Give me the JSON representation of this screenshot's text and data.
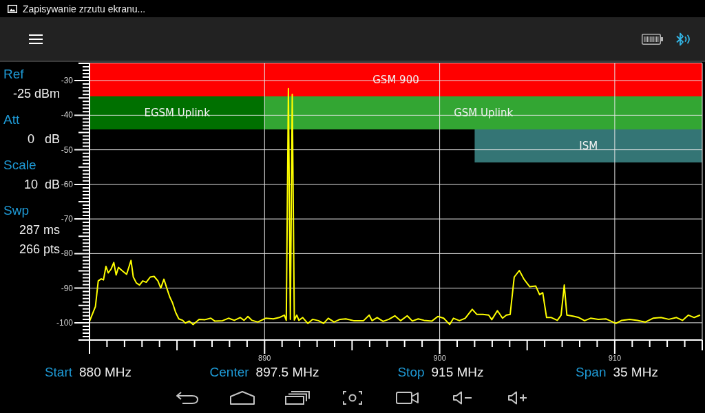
{
  "status_bar": {
    "notification": "Zapisywanie zrzutu ekranu..."
  },
  "parameters": [
    {
      "label": "Ref",
      "values": [
        "-25 dBm"
      ]
    },
    {
      "label": "Att",
      "values": [
        "0   dB"
      ]
    },
    {
      "label": "Scale",
      "values": [
        "10  dB"
      ]
    },
    {
      "label": "Swp",
      "values": [
        "287 ms",
        "266 pts"
      ]
    }
  ],
  "spectrum": {
    "chart_data": {
      "type": "line",
      "xlim": [
        880,
        915
      ],
      "ylim": [
        -105,
        -25
      ],
      "xticks": [
        890,
        900,
        910
      ],
      "yticks": [
        -30,
        -40,
        -50,
        -60,
        -70,
        -80,
        -90,
        -100
      ],
      "grid": true,
      "x": [
        880.0,
        880.34,
        880.5,
        880.67,
        880.8,
        880.94,
        881.07,
        881.23,
        881.39,
        881.52,
        881.65,
        881.9,
        882.12,
        882.37,
        882.5,
        882.68,
        882.86,
        883.04,
        883.24,
        883.47,
        883.69,
        883.91,
        884.07,
        884.25,
        884.43,
        884.58,
        884.74,
        884.92,
        885.1,
        885.32,
        885.48,
        885.7,
        885.92,
        886.26,
        886.6,
        886.93,
        887.15,
        887.6,
        887.94,
        888.27,
        888.61,
        888.83,
        889.05,
        889.28,
        889.61,
        890.06,
        890.5,
        890.84,
        891.13,
        891.24,
        891.36,
        891.47,
        891.58,
        891.7,
        891.84,
        891.96,
        892.18,
        892.47,
        892.74,
        893.08,
        893.37,
        893.64,
        893.97,
        894.31,
        894.64,
        895.09,
        895.65,
        895.98,
        896.14,
        896.43,
        896.77,
        897.1,
        897.44,
        897.77,
        898.15,
        898.44,
        898.78,
        899.11,
        899.56,
        899.9,
        900.23,
        900.57,
        900.79,
        901.13,
        901.46,
        901.86,
        902.13,
        902.47,
        902.8,
        902.98,
        903.3,
        903.59,
        903.81,
        904.03,
        904.26,
        904.55,
        904.82,
        905.15,
        905.49,
        905.71,
        905.89,
        906.11,
        906.38,
        906.72,
        906.94,
        907.12,
        907.27,
        907.61,
        907.95,
        908.28,
        908.62,
        909.06,
        909.51,
        910.07,
        910.4,
        910.85,
        911.3,
        911.75,
        912.19,
        912.64,
        913.09,
        913.53,
        913.87,
        914.21,
        914.54,
        914.88
      ],
      "series": [
        {
          "color": "#ffff00",
          "values": [
            -99.6,
            -95.3,
            -87.9,
            -87.3,
            -87.6,
            -83.7,
            -85.6,
            -84.5,
            -82.6,
            -86.2,
            -84.0,
            -85.1,
            -86.0,
            -82.0,
            -86.8,
            -88.5,
            -89.1,
            -87.9,
            -88.3,
            -86.8,
            -86.6,
            -87.9,
            -90.0,
            -87.4,
            -90.2,
            -92.5,
            -94.2,
            -97.0,
            -98.9,
            -99.3,
            -100.1,
            -99.5,
            -100.5,
            -99.0,
            -99.1,
            -98.7,
            -99.5,
            -99.4,
            -98.7,
            -99.3,
            -98.5,
            -99.3,
            -98.2,
            -99.3,
            -99.8,
            -98.7,
            -98.9,
            -98.5,
            -97.8,
            -99.3,
            -32.3,
            -99.0,
            -34.0,
            -99.2,
            -97.8,
            -99.3,
            -98.5,
            -100.2,
            -99.0,
            -99.4,
            -100.2,
            -98.7,
            -99.8,
            -99.0,
            -98.9,
            -99.4,
            -99.4,
            -97.8,
            -99.4,
            -98.5,
            -99.6,
            -99.0,
            -98.0,
            -99.4,
            -98.0,
            -99.5,
            -98.9,
            -99.3,
            -99.5,
            -98.2,
            -98.7,
            -100.5,
            -98.7,
            -99.4,
            -98.7,
            -96.1,
            -97.6,
            -97.6,
            -97.8,
            -99.1,
            -96.5,
            -98.7,
            -97.8,
            -97.6,
            -86.8,
            -84.9,
            -87.4,
            -89.6,
            -89.4,
            -91.9,
            -91.3,
            -98.5,
            -98.5,
            -99.3,
            -97.8,
            -89.1,
            -97.8,
            -98.1,
            -98.5,
            -99.4,
            -98.7,
            -99.0,
            -98.9,
            -100.2,
            -99.3,
            -99.0,
            -99.3,
            -99.8,
            -98.7,
            -98.5,
            -99.0,
            -98.5,
            -99.3,
            -97.8,
            -98.5,
            -97.8
          ]
        }
      ],
      "bands": [
        {
          "axis": "x",
          "from": 880,
          "to": 915,
          "label": "GSM 900",
          "color": "#ff0000"
        },
        {
          "axis": "x",
          "from": 880,
          "to": 890,
          "label": "EGSM Uplink",
          "color": "#007000"
        },
        {
          "axis": "x",
          "from": 890,
          "to": 915,
          "label": "GSM Uplink",
          "color": "#33a633"
        },
        {
          "axis": "x",
          "from": 902,
          "to": 915,
          "label": "ISM",
          "color": "#347575"
        }
      ]
    }
  },
  "frequencies": [
    {
      "label": "Start",
      "value": "880 MHz"
    },
    {
      "label": "Center",
      "value": "897.5 MHz"
    },
    {
      "label": "Stop",
      "value": "915 MHz"
    },
    {
      "label": "Span",
      "value": "35 MHz"
    }
  ]
}
